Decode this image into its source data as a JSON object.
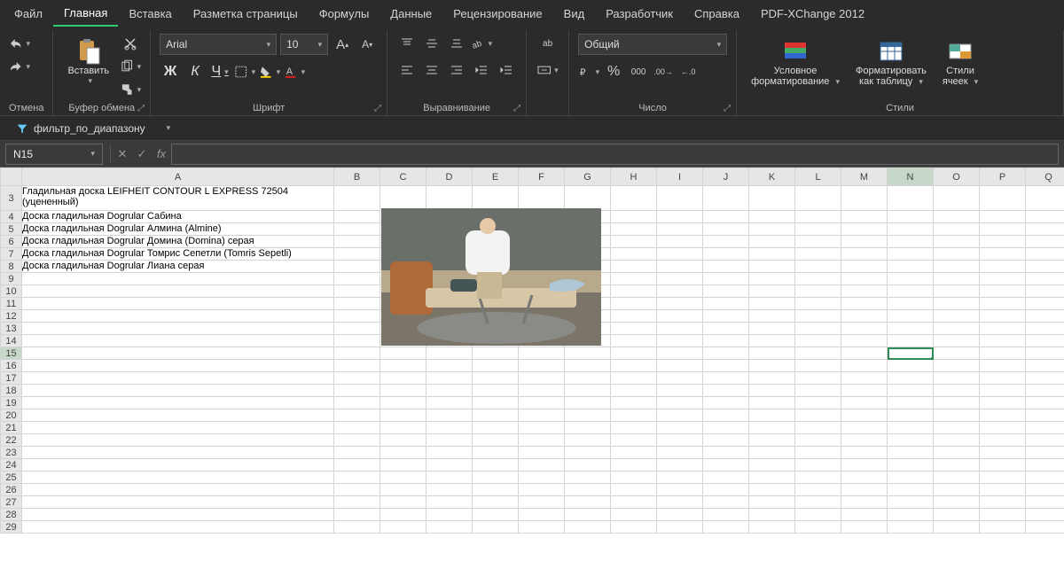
{
  "menu": {
    "items": [
      "Файл",
      "Главная",
      "Вставка",
      "Разметка страницы",
      "Формулы",
      "Данные",
      "Рецензирование",
      "Вид",
      "Разработчик",
      "Справка",
      "PDF-XChange 2012"
    ],
    "active": "Главная"
  },
  "ribbon": {
    "undo": {
      "label": "Отмена"
    },
    "clipboard": {
      "label": "Буфер обмена",
      "paste": "Вставить"
    },
    "font": {
      "label": "Шрифт",
      "name": "Arial",
      "size": "10"
    },
    "align": {
      "label": "Выравнивание",
      "wrap": "аb"
    },
    "number": {
      "label": "Число",
      "format": "Общий"
    },
    "styles": {
      "label": "Стили",
      "cond": "Условное",
      "cond2": "форматирование",
      "table": "Форматировать",
      "table2": "как таблицу",
      "cell": "Стили",
      "cell2": "ячеек"
    }
  },
  "quick": {
    "filter": "фильтр_по_диапазону"
  },
  "fx": {
    "name": "N15"
  },
  "columns": [
    "A",
    "B",
    "C",
    "D",
    "E",
    "F",
    "G",
    "H",
    "I",
    "J",
    "K",
    "L",
    "M",
    "N",
    "O",
    "P",
    "Q"
  ],
  "selected": {
    "col": "N",
    "row": 15
  },
  "rows": {
    "3": "Гладильная доска LEIFHEIT CONTOUR L EXPRESS 72504 (уцененный)",
    "4": "Доска гладильная Dogrular Сабина",
    "5": "Доска гладильная Dogrular Алмина (Almine)",
    "6": "Доска гладильная Dogrular Домина (Domina) серая",
    "7": "Доска гладильная Dogrular Томрис Сепетли (Tomris Sepetli)",
    "8": "Доска гладильная Dogrular Лиана серая"
  }
}
